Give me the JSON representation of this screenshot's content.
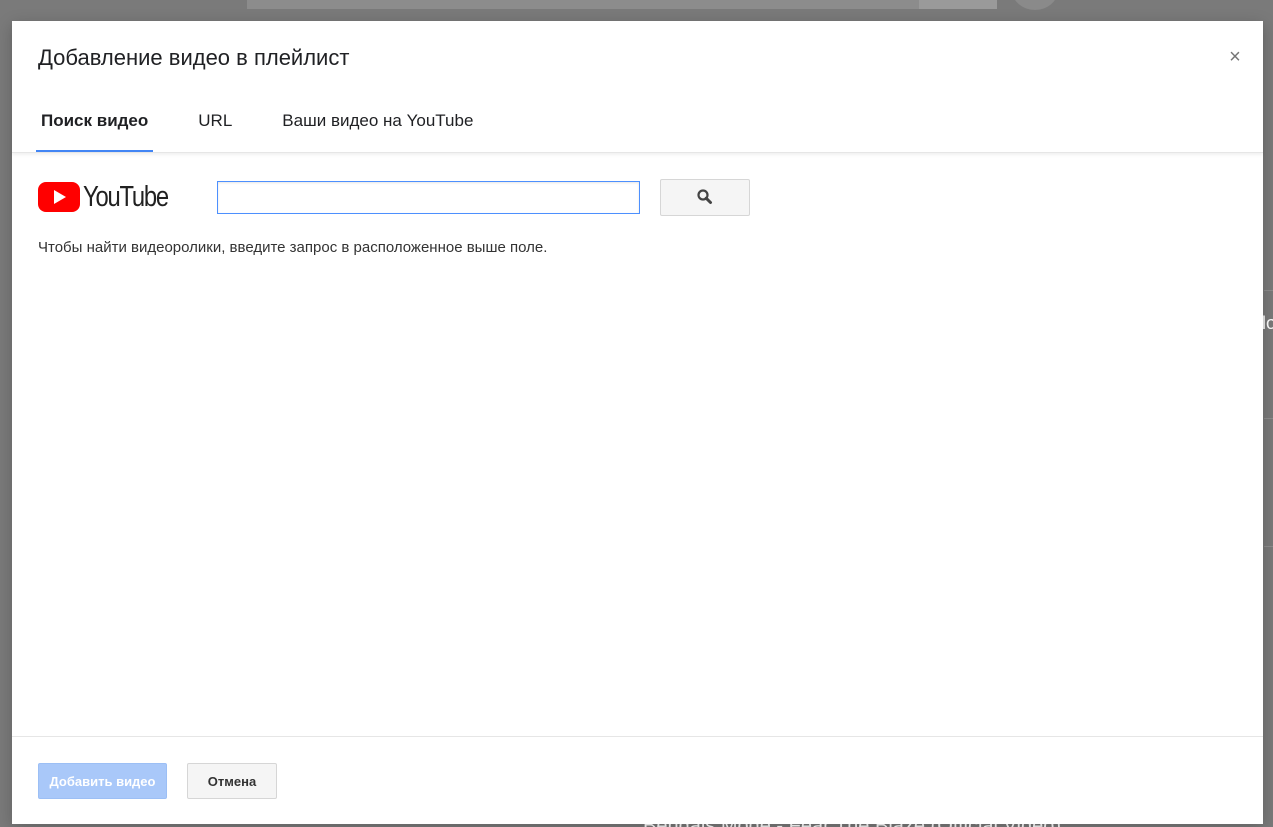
{
  "background": {
    "right_edge_text": "lo",
    "bottom_text": "Bengals Mode - Fear The Blaze (Official Video)"
  },
  "dialog": {
    "title": "Добавление видео в плейлист",
    "close_label": "×",
    "tabs": [
      {
        "label": "Поиск видео",
        "active": true
      },
      {
        "label": "URL",
        "active": false
      },
      {
        "label": "Ваши видео на YouTube",
        "active": false
      }
    ],
    "search": {
      "logo_text": "YouTube",
      "input_value": "",
      "button_icon": "search-icon"
    },
    "hint": "Чтобы найти видеоролики, введите запрос в расположенное выше поле.",
    "footer": {
      "add_label": "Добавить видео",
      "cancel_label": "Отмена"
    }
  },
  "colors": {
    "accent": "#4285f4",
    "youtube_red": "#ff0000",
    "add_button_disabled": "#a9c8f9",
    "overlay": "#7a7a7a"
  }
}
